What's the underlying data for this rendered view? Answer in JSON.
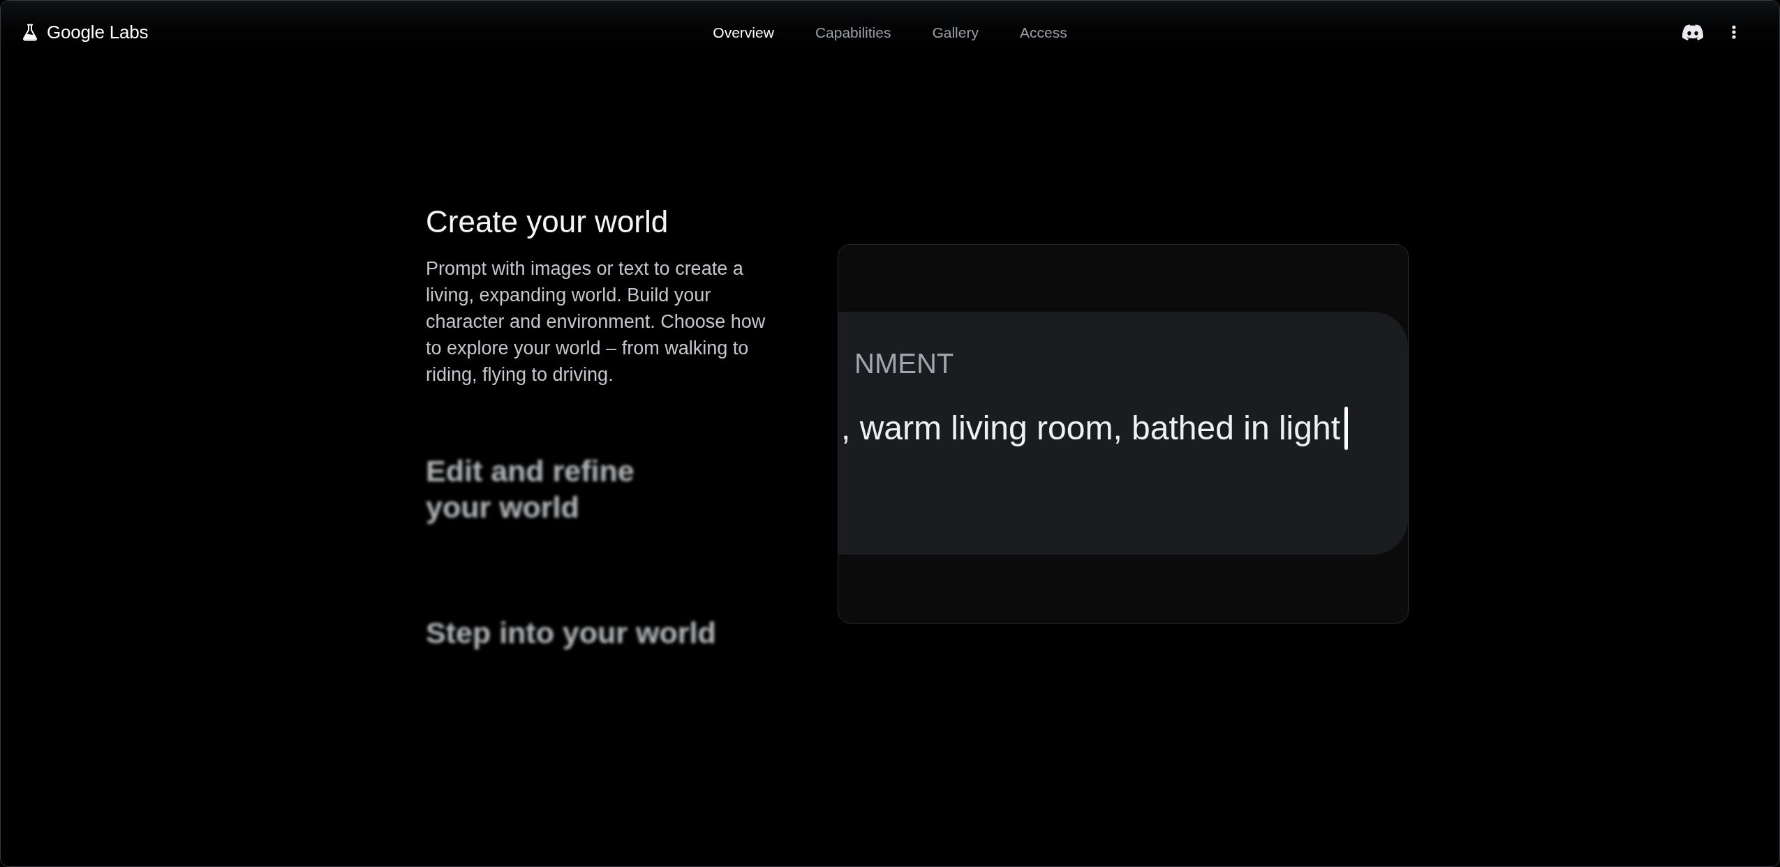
{
  "header": {
    "logo_text": "Google Labs",
    "nav": [
      {
        "label": "Overview",
        "selected": true
      },
      {
        "label": "Capabilities",
        "selected": false
      },
      {
        "label": "Gallery",
        "selected": false
      },
      {
        "label": "Access",
        "selected": false
      }
    ]
  },
  "features": [
    {
      "title": "Create your world",
      "description": "Prompt with images or text to create a living, expanding world. Build your character and environment. Choose how to explore your world – from walking to riding, flying to driving.",
      "expanded": true
    },
    {
      "title": "Edit and refine\nyour world",
      "expanded": false
    },
    {
      "title": "Step into your world",
      "expanded": false
    }
  ],
  "preview": {
    "label": "NMENT",
    "value": ", warm living room, bathed in light",
    "cursor": true
  }
}
